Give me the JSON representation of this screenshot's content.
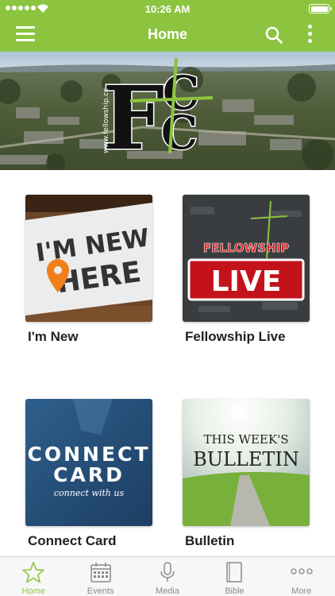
{
  "status_bar": {
    "time": "10:26 AM"
  },
  "nav": {
    "title": "Home"
  },
  "banner": {
    "logo_letters": [
      "F",
      "C",
      "C"
    ],
    "logo_url": "www.fellowship.cc"
  },
  "tiles": [
    {
      "label": "I'm New",
      "image_lines": [
        "I'M NEW",
        "HERE"
      ]
    },
    {
      "label": "Fellowship Live",
      "image_lines": [
        "FELLOWSHIP",
        "LIVE"
      ]
    },
    {
      "label": "Connect Card",
      "image_lines": [
        "CONNECT",
        "CARD",
        "connect with us"
      ]
    },
    {
      "label": "Bulletin",
      "image_lines": [
        "THIS WEEK'S",
        "BULLETIN"
      ]
    }
  ],
  "tab_bar": {
    "items": [
      {
        "label": "Home",
        "icon": "star-icon",
        "active": true
      },
      {
        "label": "Events",
        "icon": "calendar-icon",
        "active": false
      },
      {
        "label": "Media",
        "icon": "microphone-icon",
        "active": false
      },
      {
        "label": "Bible",
        "icon": "book-icon",
        "active": false
      },
      {
        "label": "More",
        "icon": "more-dots-icon",
        "active": false
      }
    ]
  },
  "colors": {
    "brand_green": "#8cc43f",
    "tab_inactive": "#8a8a8a"
  }
}
